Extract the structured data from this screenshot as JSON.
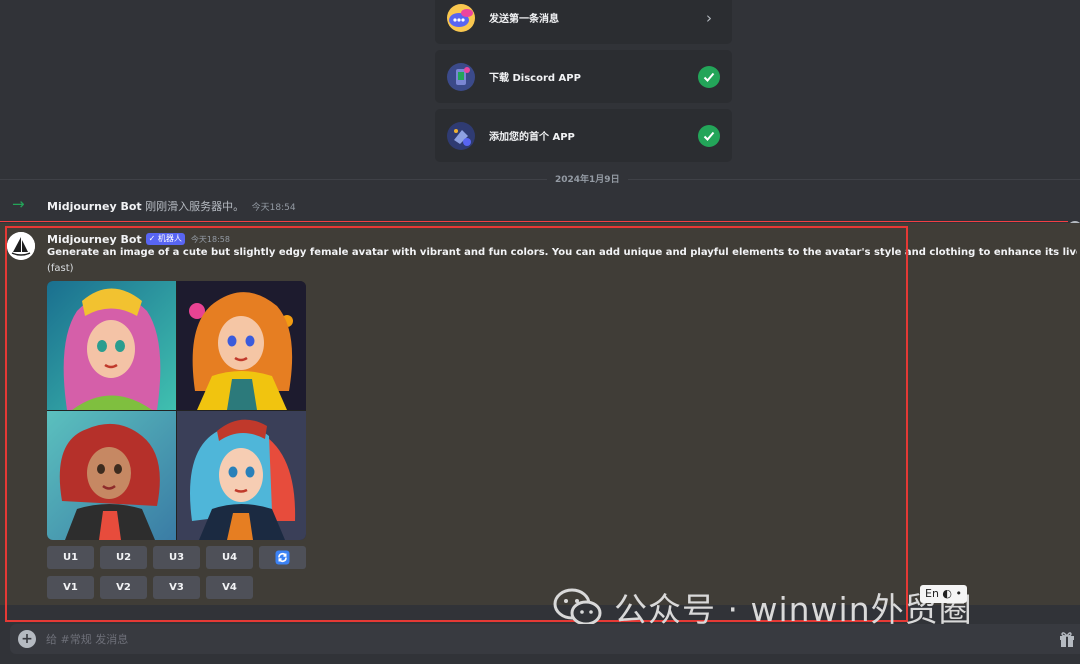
{
  "onboarding": [
    {
      "label": "发送第一条消息",
      "status": "chevron",
      "icon": "chat-bubble-icon"
    },
    {
      "label": "下载 Discord APP",
      "status": "done",
      "icon": "phone-app-icon"
    },
    {
      "label": "添加您的首个 APP",
      "status": "done",
      "icon": "puzzle-app-icon"
    }
  ],
  "date_separator": "2024年1月9日",
  "join": {
    "author": "Midjourney Bot",
    "text": "刚刚滑入服务器中。",
    "time": "今天18:54"
  },
  "message": {
    "author": "Midjourney Bot",
    "bot_tag": "✓ 机器人",
    "time": "今天18:58",
    "prompt": "Generate an image of a cute but slightly edgy female avatar with vibrant and fun colors. You can add unique and playful elements to the avatar's style and clothing to enhance its lively character.",
    "prompt_dash": " - ",
    "mention": "@",
    "mode": "(fast)",
    "upscale_buttons": [
      "U1",
      "U2",
      "U3",
      "U4"
    ],
    "reroll_icon": "refresh-icon",
    "variation_buttons": [
      "V1",
      "V2",
      "V3",
      "V4"
    ]
  },
  "composer": {
    "placeholder": "给 #常规 发消息"
  },
  "watermark": "公众号 · winwin外贸圈",
  "ime_label": "En"
}
